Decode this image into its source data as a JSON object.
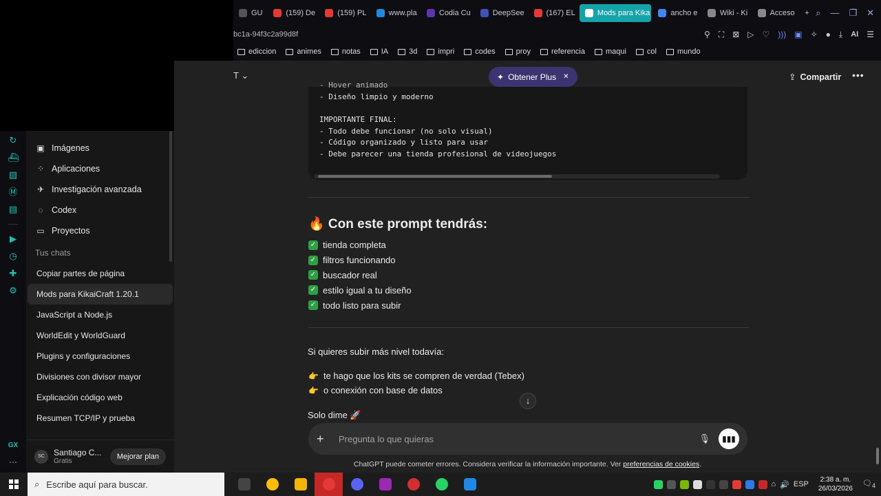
{
  "browser": {
    "tabs": [
      {
        "label": "GU",
        "color": "#555"
      },
      {
        "label": "(159) De",
        "color": "#e53935"
      },
      {
        "label": "(159) PL",
        "color": "#e53935"
      },
      {
        "label": "www.pla",
        "color": "#1e88e5"
      },
      {
        "label": "Codia Cu",
        "color": "#5e35b1"
      },
      {
        "label": "DeepSee",
        "color": "#3f51b5"
      },
      {
        "label": "(167) EL",
        "color": "#e53935"
      },
      {
        "label": "Mods para Kika",
        "color": "#ffffff",
        "active": true
      },
      {
        "label": "ancho e",
        "color": "#4285f4"
      },
      {
        "label": "Wiki - Ki",
        "color": "#888"
      },
      {
        "label": "Acceso",
        "color": "#888"
      }
    ],
    "url": "bc1a-94f3c2a99d8f",
    "ai_label": "AI",
    "bookmarks": [
      "ediccion",
      "animes",
      "notas",
      "IA",
      "3d",
      "impri",
      "codes",
      "proy",
      "referencia",
      "maqui",
      "col",
      "mundo"
    ],
    "accent": "#14a3a8"
  },
  "gx": {
    "label": "GX"
  },
  "sidebar": {
    "nav": [
      {
        "label": "Imágenes",
        "icon": "images-icon"
      },
      {
        "label": "Aplicaciones",
        "icon": "apps-icon"
      },
      {
        "label": "Investigación avanzada",
        "icon": "research-icon"
      },
      {
        "label": "Codex",
        "icon": "codex-icon"
      },
      {
        "label": "Proyectos",
        "icon": "folder-icon"
      }
    ],
    "chats_label": "Tus chats",
    "chats": [
      "Copiar partes de página",
      "Mods para KikaiCraft 1.20.1",
      "JavaScript a Node.js",
      "WorldEdit y WorldGuard",
      "Plugins y configuraciones",
      "Divisiones con divisor mayor",
      "Explicación código web",
      "Resumen TCP/IP y prueba"
    ],
    "active_chat": 1
  },
  "profile": {
    "initials": "SC",
    "name": "Santiago C...",
    "plan": "Gratis",
    "upgrade_label": "Mejorar plan"
  },
  "header": {
    "title_fragment": "T",
    "plus_label": "Obtener Plus",
    "share_label": "Compartir"
  },
  "code": {
    "lines": [
      "- Hover animado",
      "- Diseño limpio y moderno",
      "",
      "IMPORTANTE FINAL:",
      "- Todo debe funcionar (no solo visual)",
      "- Código organizado y listo para usar",
      "- Debe parecer una tienda profesional de videojuegos"
    ]
  },
  "message": {
    "heading": "🔥 Con este prompt tendrás:",
    "checks": [
      "tienda completa",
      "filtros funcionando",
      "buscador real",
      "estilo igual a tu diseño",
      "todo listo para subir"
    ],
    "intro": "Si quieres subir más nivel todavía:",
    "points": [
      "te hago que los kits se compren de verdad (Tebex)",
      "o conexión con base de datos"
    ],
    "closing": "Solo dime 🚀"
  },
  "composer": {
    "placeholder": "Pregunta lo que quieras"
  },
  "disclaimer": {
    "text": "ChatGPT puede cometer errores. Considera verificar la información importante. Ver ",
    "link": "preferencias de cookies",
    "end": "."
  },
  "taskbar": {
    "search_placeholder": "Escribe aquí para buscar.",
    "apps": [
      {
        "name": "task-view",
        "color": "#444"
      },
      {
        "name": "chrome",
        "color": "#fbbc05"
      },
      {
        "name": "explorer",
        "color": "#f4b400"
      },
      {
        "name": "opera-gx",
        "color": "#e53935"
      },
      {
        "name": "discord",
        "color": "#5865f2"
      },
      {
        "name": "game-app",
        "color": "#9c27b0"
      },
      {
        "name": "chatgpt-app",
        "color": "#d32f2f"
      },
      {
        "name": "whatsapp",
        "color": "#25d366"
      },
      {
        "name": "vscode",
        "color": "#1e88e5"
      }
    ],
    "lang": "ESP",
    "time": "2:38 a. m.",
    "date": "26/03/2026",
    "notif_count": "4"
  }
}
